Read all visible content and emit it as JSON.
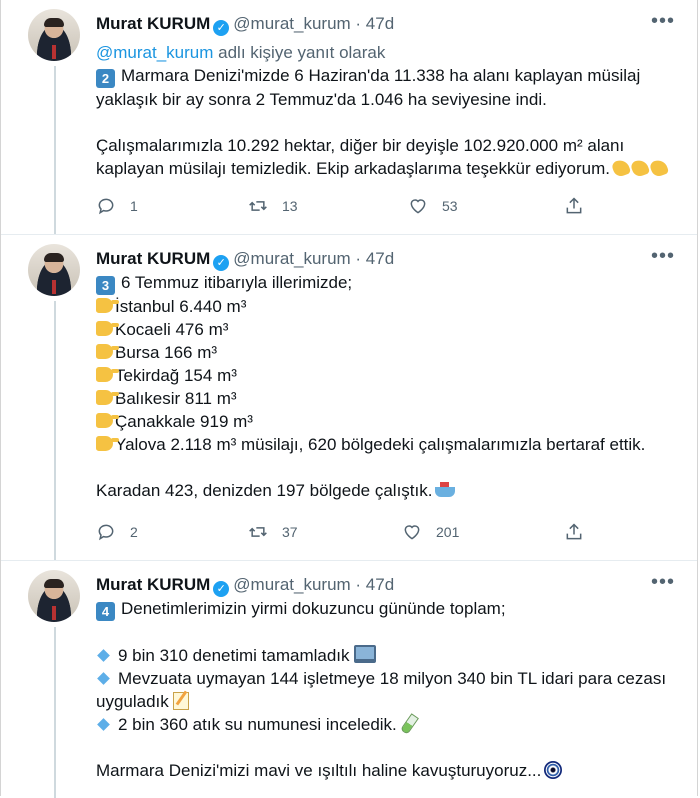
{
  "tweets": [
    {
      "author": {
        "name": "Murat KURUM",
        "handle": "@murat_kurum",
        "time": "· 47d"
      },
      "reply_to": {
        "mention": "@murat_kurum",
        "text": " adlı kişiye yanıt olarak"
      },
      "number": "2",
      "lines": [
        "Marmara Denizi'mizde 6 Haziran'da 11.338 ha alanı kaplayan müsilaj",
        "yaklaşık bir ay sonra 2 Temmuz'da 1.046 ha seviyesine indi.",
        "Çalışmalarımızla 10.292 hektar, diğer bir deyişle 102.920.000 m² alanı",
        "kaplayan müsilajı temizledik. Ekip arkadaşlarıma teşekkür ediyorum."
      ],
      "replies": "1",
      "retweets": "13",
      "likes": "53"
    },
    {
      "author": {
        "name": "Murat KURUM",
        "handle": "@murat_kurum",
        "time": "· 47d"
      },
      "number": "3",
      "intro": "6 Temmuz itibarıyla illerimizde;",
      "items": [
        "İstanbul 6.440 m³",
        "Kocaeli 476 m³",
        "Bursa 166 m³",
        "Tekirdağ 154 m³",
        "Balıkesir 811 m³",
        "Çanakkale 919 m³",
        "Yalova 2.118 m³ müsilajı, 620 bölgedeki çalışmalarımızla bertaraf ettik."
      ],
      "closing": "Karadan 423, denizden 197 bölgede çalıştık.",
      "replies": "2",
      "retweets": "37",
      "likes": "201"
    },
    {
      "author": {
        "name": "Murat KURUM",
        "handle": "@murat_kurum",
        "time": "· 47d"
      },
      "number": "4",
      "intro": "Denetimlerimizin yirmi dokuzuncu gününde toplam;",
      "items": [
        "9 bin 310 denetimi tamamladık",
        "Mevzuata uymayan 144 işletmeye 18 milyon 340 bin TL idari para cezası",
        "uyguladık",
        "2 bin 360 atık su numunesi inceledik."
      ],
      "closing": "Marmara Denizi'mizi mavi ve ışıltılı haline kavuşturuyoruz..."
    }
  ],
  "icons": {
    "reply": "speech-bubble-icon",
    "retweet": "retweet-arrows-icon",
    "like": "heart-icon",
    "share": "share-upload-icon",
    "more": "ellipsis-icon",
    "verified": "verified-badge-icon"
  },
  "colors": {
    "link": "#1b95e0",
    "muted": "#536471",
    "verified": "#1da1f2"
  }
}
